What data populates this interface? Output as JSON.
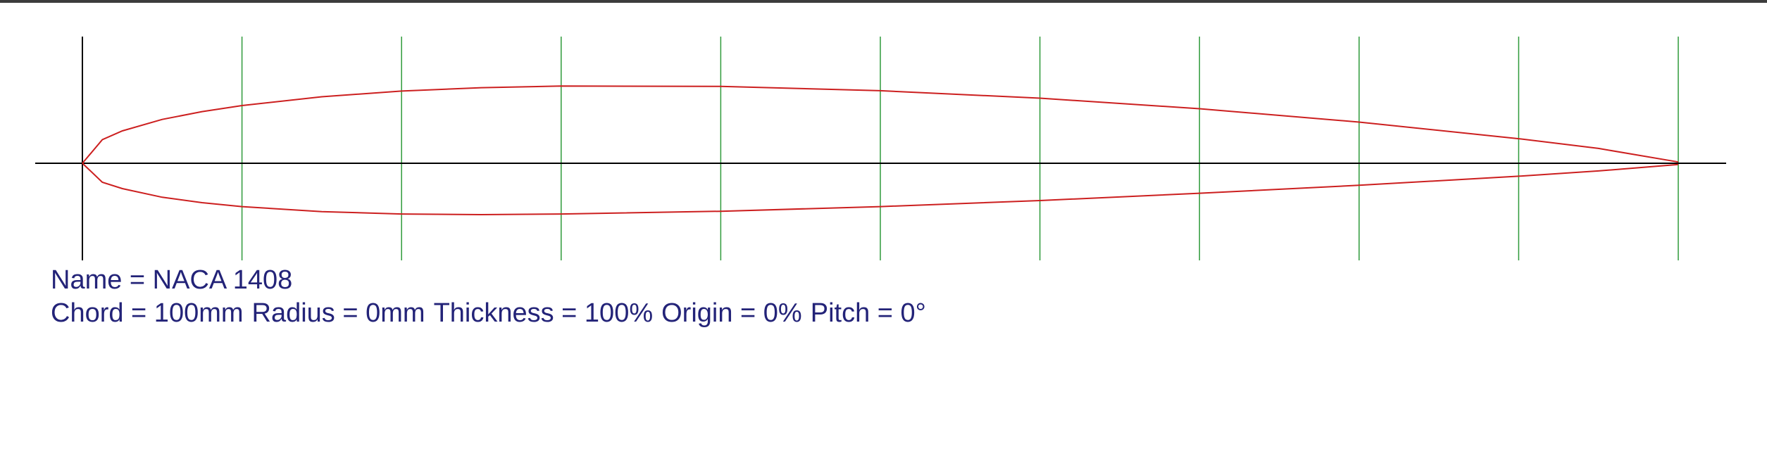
{
  "colors": {
    "airfoil": "#cc1f1f",
    "grid": "#2e9a3a",
    "axis": "#000000",
    "text": "#232378",
    "frame": "#3c3c3c"
  },
  "airfoil_data": {
    "chord_stations": 10,
    "upper": [
      [
        0,
        0
      ],
      [
        0.0125,
        0.0148
      ],
      [
        0.025,
        0.0203
      ],
      [
        0.05,
        0.0275
      ],
      [
        0.075,
        0.0324
      ],
      [
        0.1,
        0.0362
      ],
      [
        0.15,
        0.0417
      ],
      [
        0.2,
        0.0453
      ],
      [
        0.25,
        0.0474
      ],
      [
        0.3,
        0.0484
      ],
      [
        0.4,
        0.0482
      ],
      [
        0.5,
        0.0455
      ],
      [
        0.6,
        0.0408
      ],
      [
        0.7,
        0.0342
      ],
      [
        0.8,
        0.0258
      ],
      [
        0.9,
        0.0154
      ],
      [
        0.95,
        0.0093
      ],
      [
        1.0,
        0.0008
      ]
    ],
    "lower": [
      [
        0,
        0
      ],
      [
        0.0125,
        -0.0119
      ],
      [
        0.025,
        -0.0159
      ],
      [
        0.05,
        -0.0213
      ],
      [
        0.075,
        -0.0247
      ],
      [
        0.1,
        -0.0272
      ],
      [
        0.15,
        -0.0303
      ],
      [
        0.2,
        -0.0318
      ],
      [
        0.25,
        -0.0322
      ],
      [
        0.3,
        -0.0318
      ],
      [
        0.4,
        -0.0301
      ],
      [
        0.5,
        -0.0272
      ],
      [
        0.6,
        -0.0234
      ],
      [
        0.7,
        -0.0188
      ],
      [
        0.8,
        -0.0138
      ],
      [
        0.9,
        -0.0081
      ],
      [
        0.95,
        -0.0048
      ],
      [
        1.0,
        -0.0008
      ]
    ]
  },
  "info": {
    "name": "Name = NACA 1408",
    "chord": "Chord = 100mm",
    "radius": "Radius = 0mm",
    "thickness": "Thickness = 100%",
    "origin": "Origin = 0%",
    "pitch": "Pitch = 0°"
  }
}
